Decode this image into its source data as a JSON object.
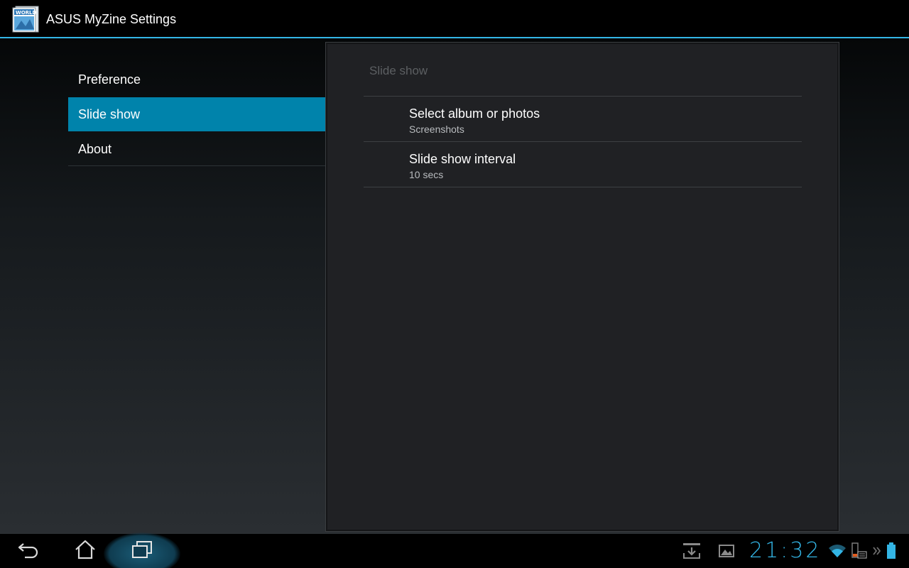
{
  "app": {
    "title": "ASUS MyZine Settings",
    "icon": "myzine-app-icon",
    "icon_text": "WORLD"
  },
  "headers": [
    {
      "label": "Preference",
      "selected": false
    },
    {
      "label": "Slide show",
      "selected": true
    },
    {
      "label": "About",
      "selected": false
    }
  ],
  "panel": {
    "title": "Slide show",
    "items": [
      {
        "title": "Select album or photos",
        "summary": "Screenshots"
      },
      {
        "title": "Slide show interval",
        "summary": "10 secs"
      }
    ]
  },
  "system_bar": {
    "clock": "21:32",
    "nav": [
      "back-icon",
      "home-icon",
      "recent-apps-icon"
    ],
    "status_icons": [
      "download-icon",
      "gallery-icon",
      "wifi-icon",
      "battery-keyboard-icon",
      "chevron-icon",
      "battery-icon"
    ]
  },
  "colors": {
    "accent": "#33b5e5",
    "selected_header": "#0083ab"
  }
}
